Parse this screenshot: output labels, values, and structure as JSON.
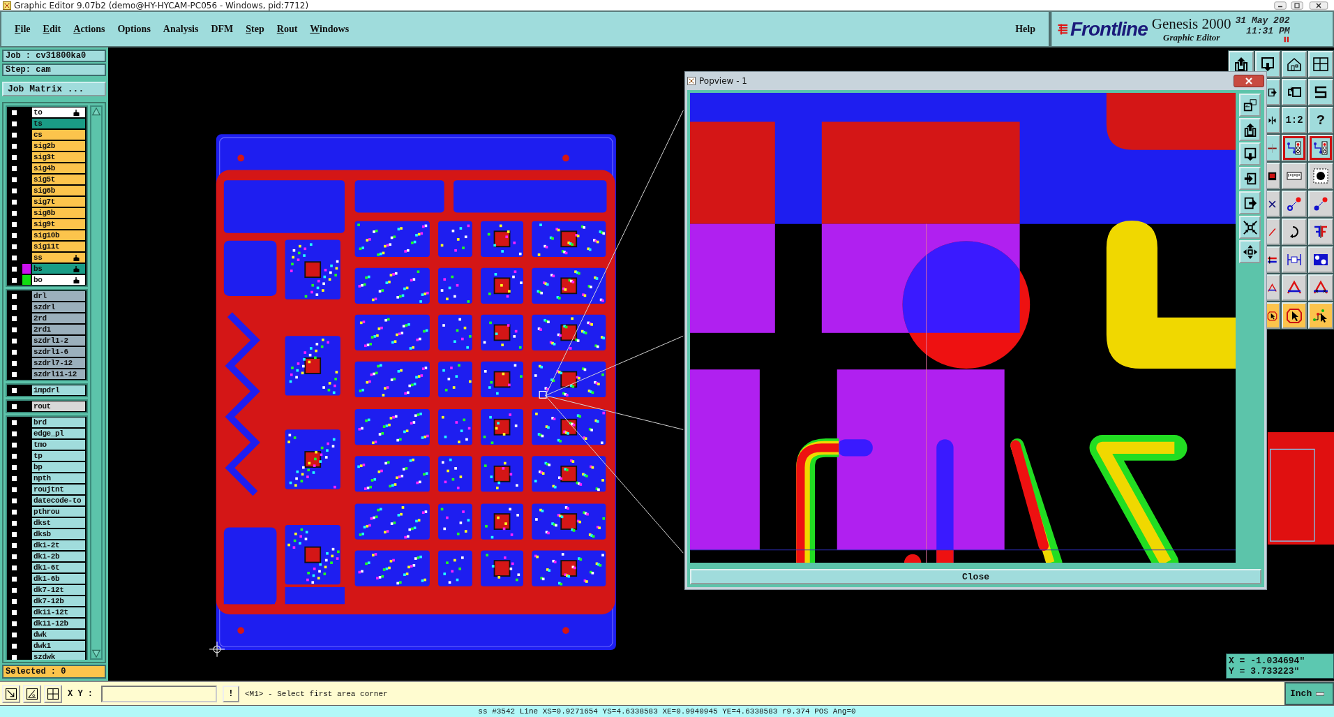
{
  "window": {
    "title": "Graphic Editor 9.07b2 (demo@HY-HYCAM-PC056 - Windows, pid:7712)"
  },
  "menu": [
    {
      "label": "File",
      "underline_first": true
    },
    {
      "label": "Edit",
      "underline_first": true
    },
    {
      "label": "Actions",
      "underline_first": true
    },
    {
      "label": "Options",
      "underline_first": false
    },
    {
      "label": "Analysis",
      "underline_first": false
    },
    {
      "label": "DFM",
      "underline_first": false
    },
    {
      "label": "Step",
      "underline_first": true
    },
    {
      "label": "Rout",
      "underline_first": true
    },
    {
      "label": "Windows",
      "underline_first": true
    }
  ],
  "help": "Help",
  "brand": {
    "logo": "Frontline",
    "product": "Genesis 2000",
    "subtitle": "Graphic Editor",
    "date": "31 May 202",
    "time": "11:31 PM"
  },
  "job_panel": {
    "job": "Job : cv31800ka0",
    "step": "Step: cam",
    "matrix_button": "Job Matrix ...",
    "selected": "Selected : 0",
    "layer_groups": [
      {
        "layers": [
          {
            "name": "to",
            "color": "#ffffff",
            "pointer": true,
            "checked": false
          },
          {
            "name": "ts",
            "color": "#1a9c86",
            "pointer": false,
            "checked": false
          },
          {
            "name": "cs",
            "color": "#fcc44c",
            "pointer": false,
            "checked": false
          },
          {
            "name": "sig2b",
            "color": "#fcc44c",
            "pointer": false,
            "checked": false
          },
          {
            "name": "sig3t",
            "color": "#fcc44c",
            "pointer": false,
            "checked": false
          },
          {
            "name": "sig4b",
            "color": "#fcc44c",
            "pointer": false,
            "checked": false
          },
          {
            "name": "sig5t",
            "color": "#fcc44c",
            "pointer": false,
            "checked": false
          },
          {
            "name": "sig6b",
            "color": "#fcc44c",
            "pointer": false,
            "checked": false
          },
          {
            "name": "sig7t",
            "color": "#fcc44c",
            "pointer": false,
            "checked": false
          },
          {
            "name": "sig8b",
            "color": "#fcc44c",
            "pointer": false,
            "checked": false
          },
          {
            "name": "sig9t",
            "color": "#fcc44c",
            "pointer": false,
            "checked": false
          },
          {
            "name": "sig10b",
            "color": "#fcc44c",
            "pointer": false,
            "checked": false
          },
          {
            "name": "sig11t",
            "color": "#fcc44c",
            "pointer": false,
            "checked": false
          },
          {
            "name": "ss",
            "color": "#fcc44c",
            "pointer": true,
            "checked": false
          },
          {
            "name": "bs",
            "color": "#1a9c86",
            "swatch": {
              "color": "#cc11ee"
            },
            "pointer": true,
            "checked": false
          },
          {
            "name": "bo",
            "color": "#ffffff",
            "swatch": {
              "color": "#11dd11"
            },
            "pointer": true,
            "checked": false
          }
        ]
      },
      {
        "layers": [
          {
            "name": "drl",
            "color": "#9bb0bc",
            "pointer": false,
            "checked": false
          },
          {
            "name": "szdrl",
            "color": "#9bb0bc",
            "pointer": false,
            "checked": false
          },
          {
            "name": "2rd",
            "color": "#9bb0bc",
            "pointer": false,
            "checked": false
          },
          {
            "name": "2rd1",
            "color": "#9bb0bc",
            "pointer": false,
            "checked": false
          },
          {
            "name": "szdrl1-2",
            "color": "#9bb0bc",
            "pointer": false,
            "checked": false
          },
          {
            "name": "szdrl1-6",
            "color": "#9bb0bc",
            "pointer": false,
            "checked": false
          },
          {
            "name": "szdrl7-12",
            "color": "#9bb0bc",
            "pointer": false,
            "checked": false
          },
          {
            "name": "szdrl11-12",
            "color": "#9bb0bc",
            "pointer": false,
            "checked": false
          }
        ]
      },
      {
        "layers": [
          {
            "name": "1mpdrl",
            "color": "#a0dcdc",
            "pointer": false,
            "checked": false
          }
        ]
      },
      {
        "layers": [
          {
            "name": "rout",
            "color": "#d8d8d8",
            "pointer": false,
            "checked": false
          }
        ]
      },
      {
        "layers": [
          {
            "name": "brd",
            "color": "#a0dcdc",
            "pointer": false,
            "checked": false
          },
          {
            "name": "edge_pl",
            "color": "#a0dcdc",
            "pointer": false,
            "checked": false
          },
          {
            "name": "tmo",
            "color": "#a0dcdc",
            "pointer": false,
            "checked": false
          },
          {
            "name": "tp",
            "color": "#a0dcdc",
            "pointer": false,
            "checked": false
          },
          {
            "name": "bp",
            "color": "#a0dcdc",
            "pointer": false,
            "checked": false
          },
          {
            "name": "npth",
            "color": "#a0dcdc",
            "pointer": false,
            "checked": false
          },
          {
            "name": "roujtnt",
            "color": "#a0dcdc",
            "pointer": false,
            "checked": false
          },
          {
            "name": "datecode-to",
            "color": "#a0dcdc",
            "pointer": false,
            "checked": false
          },
          {
            "name": "pthrou",
            "color": "#a0dcdc",
            "pointer": false,
            "checked": false
          },
          {
            "name": "dkst",
            "color": "#a0dcdc",
            "pointer": false,
            "checked": false
          },
          {
            "name": "dksb",
            "color": "#a0dcdc",
            "pointer": false,
            "checked": false
          },
          {
            "name": "dk1-2t",
            "color": "#a0dcdc",
            "pointer": false,
            "checked": false
          },
          {
            "name": "dk1-2b",
            "color": "#a0dcdc",
            "pointer": false,
            "checked": false
          },
          {
            "name": "dk1-6t",
            "color": "#a0dcdc",
            "pointer": false,
            "checked": false
          },
          {
            "name": "dk1-6b",
            "color": "#a0dcdc",
            "pointer": false,
            "checked": false
          },
          {
            "name": "dk7-12t",
            "color": "#a0dcdc",
            "pointer": false,
            "checked": false
          },
          {
            "name": "dk7-12b",
            "color": "#a0dcdc",
            "pointer": false,
            "checked": false
          },
          {
            "name": "dk11-12t",
            "color": "#a0dcdc",
            "pointer": false,
            "checked": false
          },
          {
            "name": "dk11-12b",
            "color": "#a0dcdc",
            "pointer": false,
            "checked": false
          },
          {
            "name": "dwk",
            "color": "#a0dcdc",
            "pointer": false,
            "checked": false
          },
          {
            "name": "dwk1",
            "color": "#a0dcdc",
            "pointer": false,
            "checked": false
          },
          {
            "name": "szdwk",
            "color": "#a0dcdc",
            "pointer": false,
            "checked": false
          }
        ]
      }
    ]
  },
  "toolbar": {
    "scale_label": "1:2",
    "help_label": "?"
  },
  "popview": {
    "title": "Popview - 1",
    "close_button": "Close"
  },
  "coordinates": {
    "x": "X = -1.034694\"",
    "y": "Y = 3.733223\""
  },
  "command_bar": {
    "field_label": "X Y :",
    "bang_button": "!",
    "prompt": "<M1> - Select first area corner",
    "units": "Inch"
  },
  "status_bar": "ss #3542 Line XS=0.9271654 YS=4.6338583 XE=0.9940945 YE=4.6338583 r9.374 POS Ang=0"
}
